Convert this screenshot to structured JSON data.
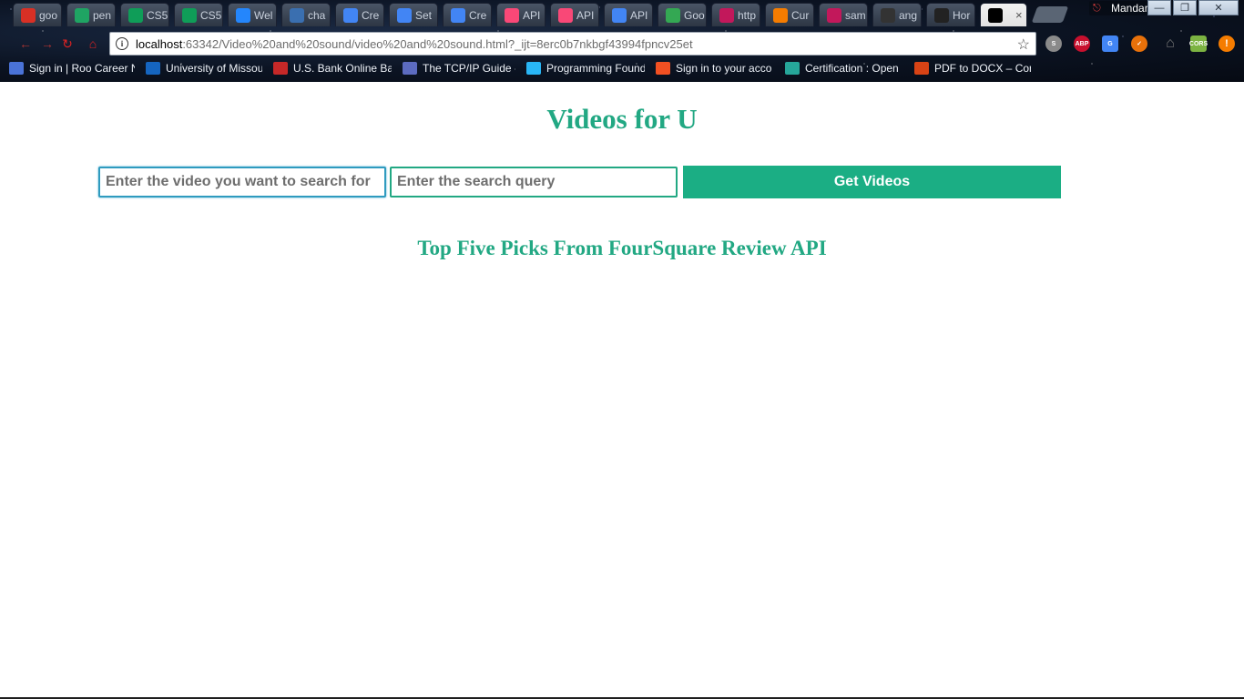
{
  "browser": {
    "tabs": [
      {
        "label": "goo",
        "icon": "gmail-icon",
        "color": "#d93025"
      },
      {
        "label": "pen",
        "icon": "google-drive-icon",
        "color": "#1fa463"
      },
      {
        "label": "CS5",
        "icon": "google-sheets-icon",
        "color": "#0f9d58"
      },
      {
        "label": "CS5",
        "icon": "google-sheets-icon",
        "color": "#0f9d58"
      },
      {
        "label": "Wel",
        "icon": "box-icon",
        "color": "#2486fc"
      },
      {
        "label": "cha",
        "icon": "puzzle-icon",
        "color": "#3a6fb0"
      },
      {
        "label": "Cre",
        "icon": "google-icon",
        "color": "#4285f4"
      },
      {
        "label": "Set",
        "icon": "google-icon",
        "color": "#4285f4"
      },
      {
        "label": "Cre",
        "icon": "google-icon",
        "color": "#4285f4"
      },
      {
        "label": "API",
        "icon": "foursquare-icon",
        "color": "#f94877"
      },
      {
        "label": "API",
        "icon": "foursquare-icon",
        "color": "#f94877"
      },
      {
        "label": "API",
        "icon": "google-icon",
        "color": "#4285f4"
      },
      {
        "label": "Goo",
        "icon": "google-icon",
        "color": "#34a853"
      },
      {
        "label": "http",
        "icon": "document-icon",
        "color": "#c2185b"
      },
      {
        "label": "Cur",
        "icon": "tool-icon",
        "color": "#f57c00"
      },
      {
        "label": "sam",
        "icon": "document-icon",
        "color": "#c2185b"
      },
      {
        "label": "ang",
        "icon": "cb-icon",
        "color": "#333333"
      },
      {
        "label": "Hor",
        "icon": "github-icon",
        "color": "#222222"
      },
      {
        "label": "",
        "icon": "webstorm-icon",
        "color": "#000000",
        "active": true
      }
    ],
    "user_name": "Mandar",
    "url": {
      "host": "localhost",
      "rest": ":63342/Video%20and%20sound/video%20and%20sound.html?_ijt=8erc0b7nkbgf43994fpncv25et"
    },
    "bookmarks": [
      {
        "label": "Sign in | Roo Career N",
        "icon": "bookmark-icon",
        "color": "#4a73d8"
      },
      {
        "label": "University of Missou",
        "icon": "university-icon",
        "color": "#1565c0"
      },
      {
        "label": "U.S. Bank Online Ban",
        "icon": "bank-icon",
        "color": "#c62828"
      },
      {
        "label": "The TCP/IP Guide - In",
        "icon": "network-icon",
        "color": "#5c6bc0"
      },
      {
        "label": "Programming Found",
        "icon": "wiki-icon",
        "color": "#29b6f6"
      },
      {
        "label": "Sign in to your acco",
        "icon": "microsoft-icon",
        "color": "#f25022"
      },
      {
        "label": "Certification : Open",
        "icon": "certificate-icon",
        "color": "#26a69a"
      },
      {
        "label": "PDF to DOCX – Conv",
        "icon": "pdf-icon",
        "color": "#d84315"
      }
    ]
  },
  "page": {
    "title": "Videos for U",
    "video_input_placeholder": "Enter the video you want to search for",
    "query_input_placeholder": "Enter the search query",
    "button_label": "Get Videos",
    "subtitle": "Top Five Picks From FourSquare Review API",
    "accent_color": "#22a883"
  }
}
